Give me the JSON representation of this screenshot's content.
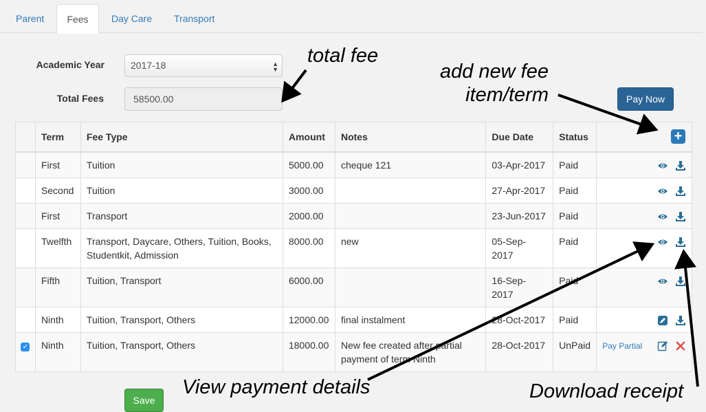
{
  "tabs": [
    {
      "label": "Parent"
    },
    {
      "label": "Fees"
    },
    {
      "label": "Day Care"
    },
    {
      "label": "Transport"
    }
  ],
  "form": {
    "academic_year_label": "Academic Year",
    "academic_year_value": "2017-18",
    "total_fees_label": "Total Fees",
    "total_fees_value": "58500.00",
    "pay_now_label": "Pay Now"
  },
  "table": {
    "headers": [
      "Term",
      "Fee Type",
      "Amount",
      "Notes",
      "Due Date",
      "Status"
    ],
    "add_icon": "plus-square-icon",
    "rows": [
      {
        "term": "First",
        "fee_type": "Tuition",
        "amount": "5000.00",
        "notes": "cheque 121",
        "due_date": "03-Apr-2017",
        "status": "Paid"
      },
      {
        "term": "Second",
        "fee_type": "Tuition",
        "amount": "3000.00",
        "notes": "",
        "due_date": "27-Apr-2017",
        "status": "Paid"
      },
      {
        "term": "First",
        "fee_type": "Transport",
        "amount": "2000.00",
        "notes": "",
        "due_date": "23-Jun-2017",
        "status": "Paid"
      },
      {
        "term": "Twelfth",
        "fee_type": "Transport, Daycare, Others, Tuition, Books, Studentkit, Admission",
        "amount": "8000.00",
        "notes": "new",
        "due_date": "05-Sep-2017",
        "status": "Paid"
      },
      {
        "term": "Fifth",
        "fee_type": "Tuition, Transport",
        "amount": "6000.00",
        "notes": "",
        "due_date": "16-Sep-2017",
        "status": "Paid"
      },
      {
        "term": "Ninth",
        "fee_type": "Tuition, Transport, Others",
        "amount": "12000.00",
        "notes": "final instalment",
        "due_date": "28-Oct-2017",
        "status": "Paid"
      },
      {
        "term": "Ninth",
        "fee_type": "Tuition, Transport, Others",
        "amount": "18000.00",
        "notes": "New fee created after partial payment of term Ninth",
        "due_date": "28-Oct-2017",
        "status": "UnPaid",
        "pay_partial_label": "Pay Partial",
        "checked": true
      }
    ]
  },
  "save_label": "Save",
  "annotations": {
    "total_fee": "total fee",
    "add_new_fee_line1": "add new fee",
    "add_new_fee_line2": "item/term",
    "view_payment": "View payment details",
    "download_receipt": "Download receipt"
  },
  "colors": {
    "link": "#337ab7",
    "primary": "#2a6496",
    "success": "#4cae4c",
    "danger": "#d9534f",
    "icon": "#2a6e96"
  }
}
